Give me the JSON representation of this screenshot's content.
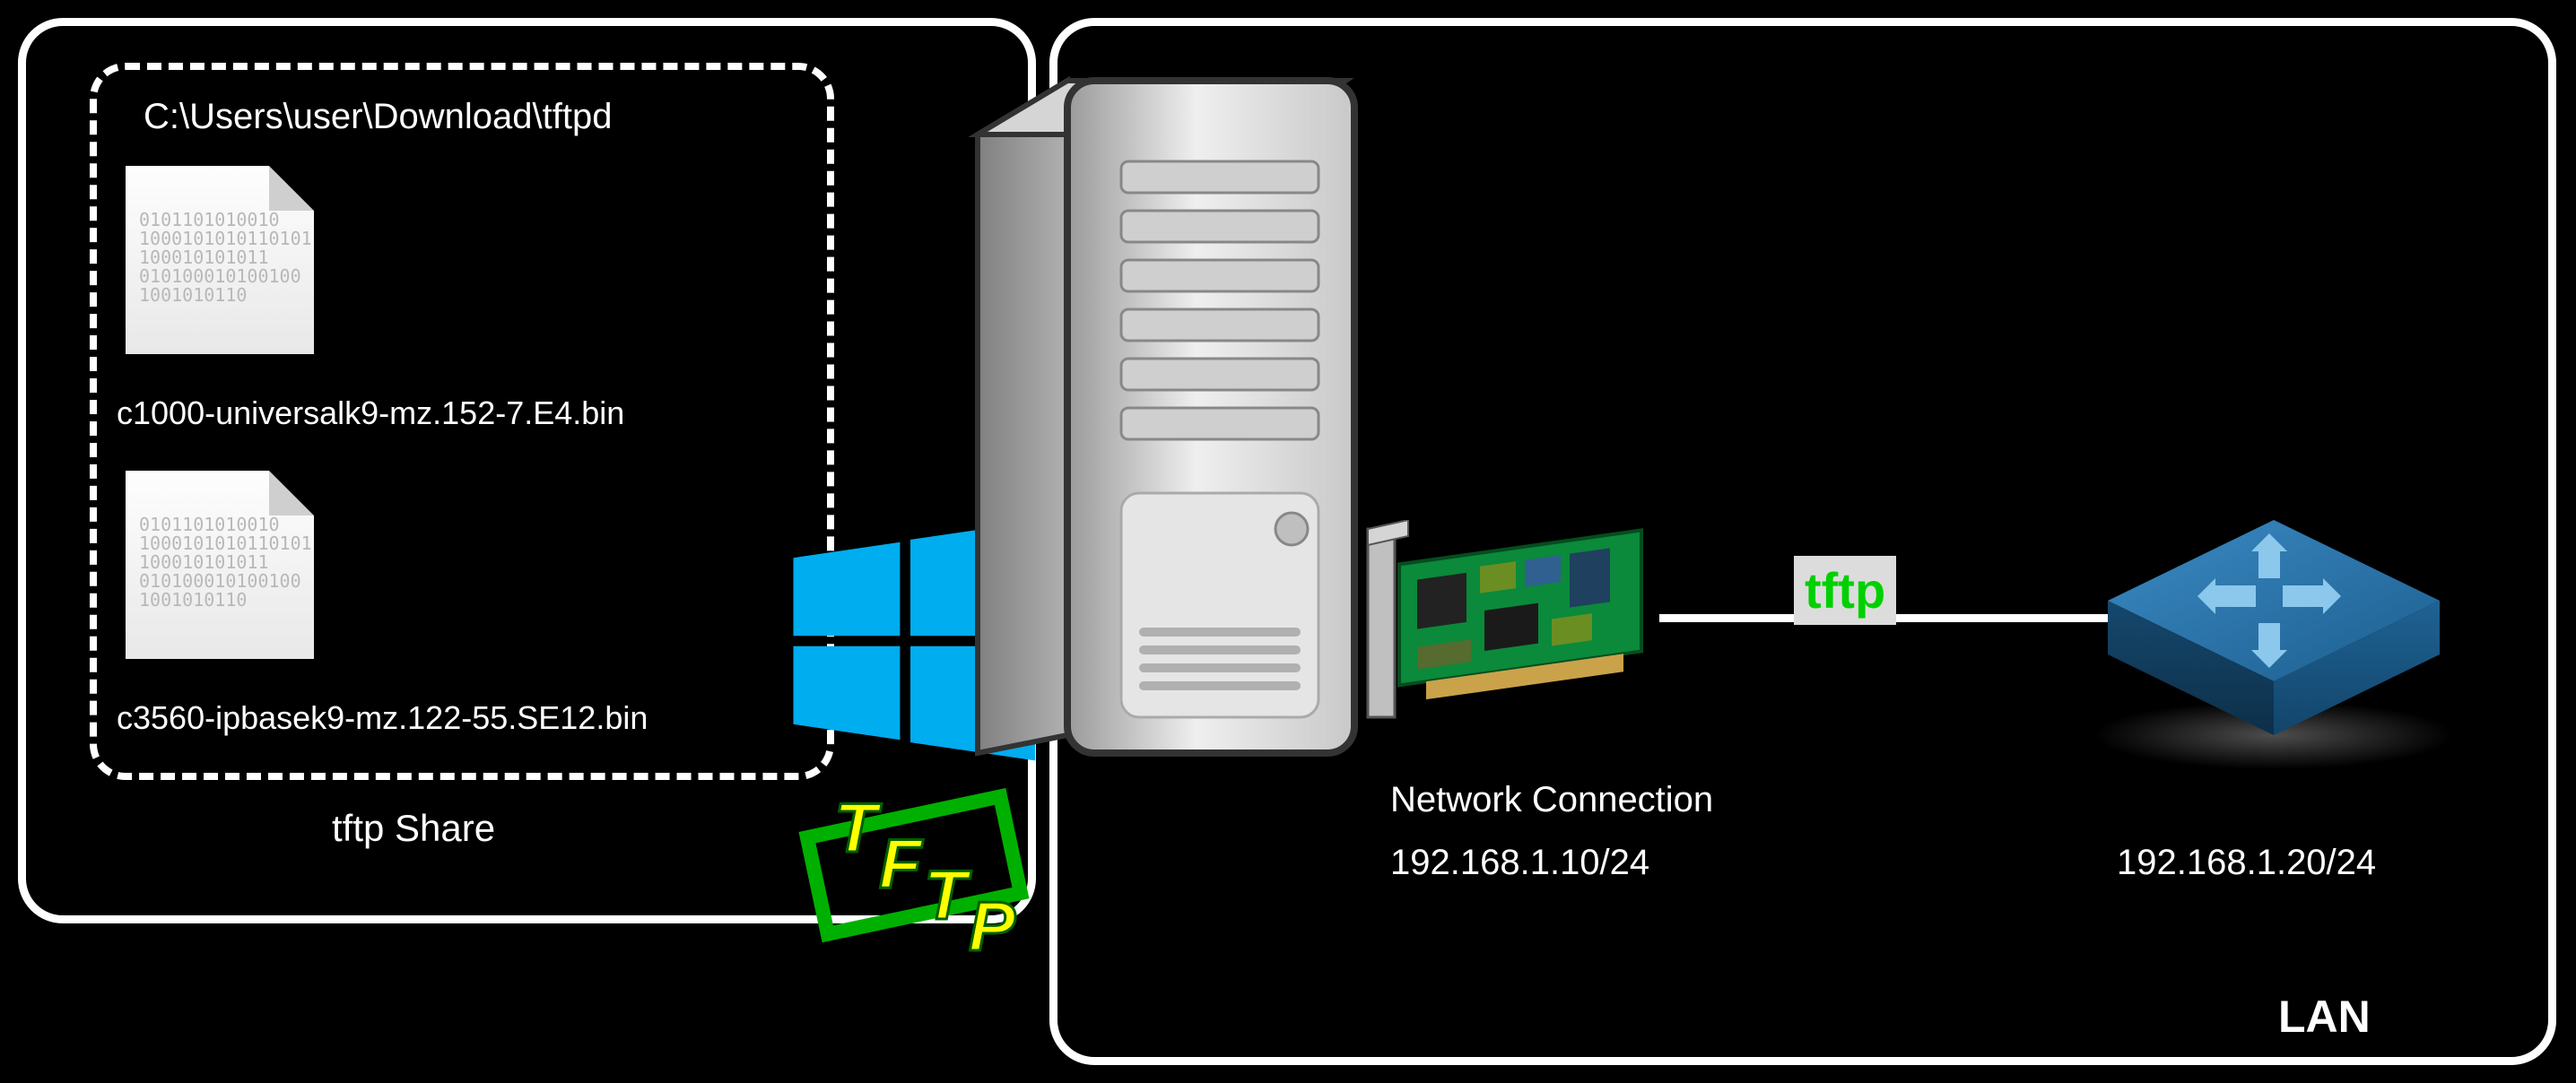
{
  "share": {
    "path": "C:\\Users\\user\\Download\\tftpd",
    "label": "tftp Share",
    "files": [
      {
        "name": "c1000-universalk9-mz.152-7.E4.bin"
      },
      {
        "name": "c3560-ipbasek9-mz.122-55.SE12.bin"
      }
    ]
  },
  "protocol": {
    "label": "tftp"
  },
  "nic": {
    "label": "Network Connection",
    "ip": "192.168.1.10/24"
  },
  "switch": {
    "ip": "192.168.1.20/24"
  },
  "lan": {
    "label": "LAN"
  },
  "binary_text": "0101101010010\n1000101010110101\n100010101011\n010100010100100\n1001010110"
}
